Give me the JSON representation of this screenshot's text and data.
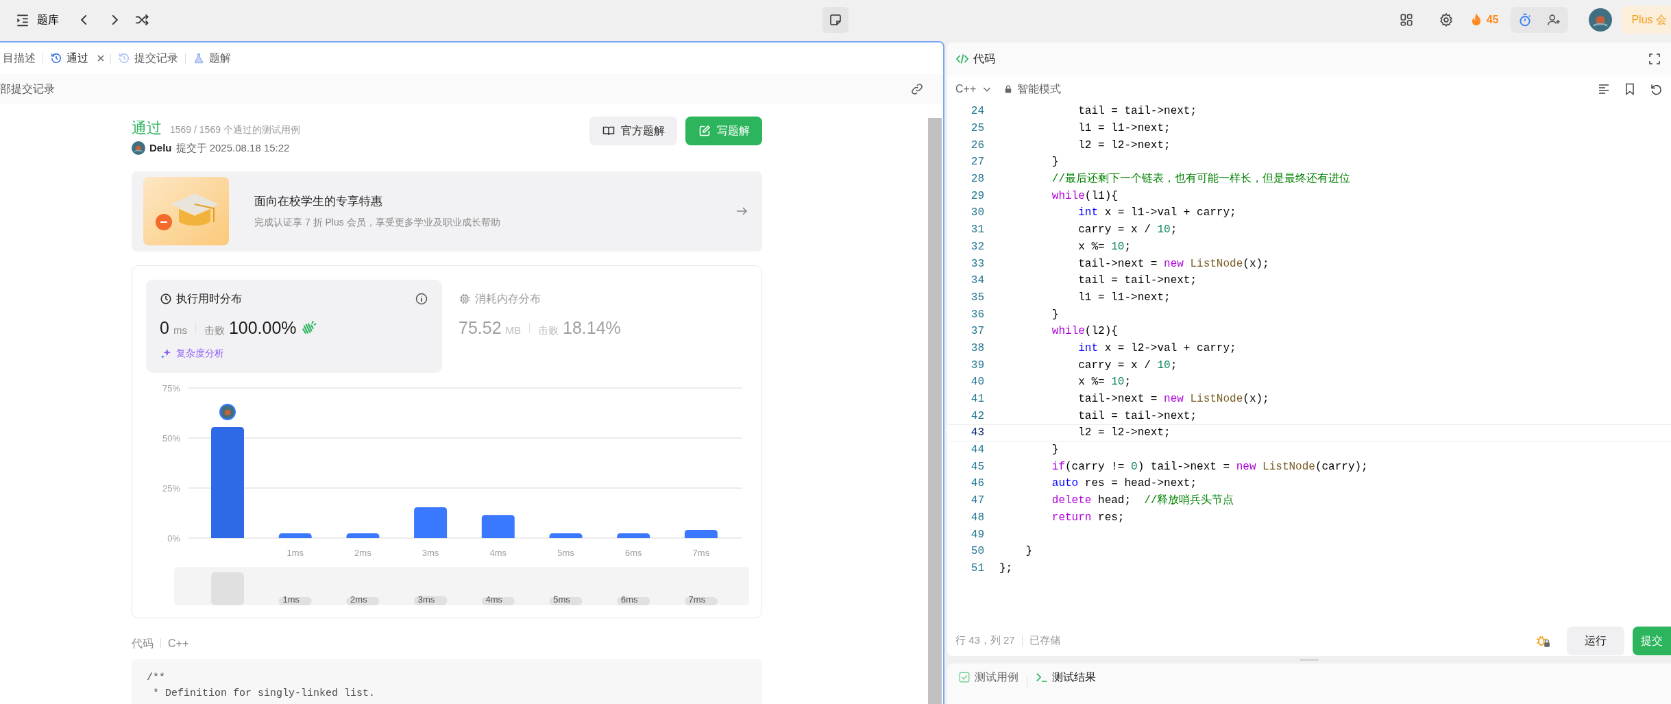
{
  "top_bar": {
    "title": "题库",
    "streak": "45",
    "plus_button": "Plus 会"
  },
  "left_panel": {
    "tabs": [
      {
        "label": "目描述",
        "kind": "description",
        "selected": false,
        "closable": false
      },
      {
        "label": "通过",
        "kind": "result",
        "selected": true,
        "closable": true
      },
      {
        "label": "提交记录",
        "kind": "submissions",
        "selected": false,
        "closable": false
      },
      {
        "label": "题解",
        "kind": "solutions",
        "selected": false,
        "closable": false
      }
    ],
    "back_link": "部提交记录",
    "submission": {
      "status": "通过",
      "testcases": "1569 / 1569 个通过的测试用例",
      "user": "Delu",
      "submitted": "提交于 2025.08.18 15:22",
      "buttons": [
        {
          "label": "官方题解",
          "kind": "secondary"
        },
        {
          "label": "写题解",
          "kind": "primary"
        }
      ]
    },
    "promo": {
      "title": "面向在校学生的专享特惠",
      "subtitle": "完成认证享 7 折 Plus 会员，享受更多学业及职业成长帮助"
    },
    "stats": [
      {
        "kind": "runtime",
        "title": "执行用时分布",
        "value": "0",
        "unit": "ms",
        "beats_label": "击败",
        "beats": "100.00%",
        "selected": true,
        "link": "复杂度分析"
      },
      {
        "kind": "memory",
        "title": "消耗内存分布",
        "value": "75.52",
        "unit": "MB",
        "beats_label": "击败",
        "beats": "18.14%",
        "selected": false
      }
    ],
    "chart_data": {
      "type": "bar",
      "categories": [
        null,
        "1ms",
        "2ms",
        "3ms",
        "4ms",
        "5ms",
        "6ms",
        "7ms"
      ],
      "values": [
        55.5,
        2.4,
        2.4,
        15.4,
        11.6,
        2.4,
        2.4,
        4.1
      ],
      "ylim": [
        0,
        75
      ],
      "yticks": [
        {
          "value": 0,
          "label": "0%"
        },
        {
          "value": 25,
          "label": "25%"
        },
        {
          "value": 50,
          "label": "50%"
        },
        {
          "value": 75,
          "label": "75%"
        }
      ]
    },
    "range_labels": [
      "1ms",
      "2ms",
      "3ms",
      "4ms",
      "5ms",
      "6ms",
      "7ms"
    ],
    "code_label": "代码",
    "code_language": "C++",
    "code": [
      "/**",
      " * Definition for singly-linked list."
    ]
  },
  "editor": {
    "title": "代码",
    "language": "C++",
    "mode": "智能模式",
    "lines": [
      {
        "num": "24",
        "current": false,
        "tokens": [
          {
            "kind": "plain",
            "text": "            tail = tail->next;"
          }
        ]
      },
      {
        "num": "25",
        "current": false,
        "tokens": [
          {
            "kind": "plain",
            "text": "            l1 = l1->next;"
          }
        ]
      },
      {
        "num": "26",
        "current": false,
        "tokens": [
          {
            "kind": "plain",
            "text": "            l2 = l2->next;"
          }
        ]
      },
      {
        "num": "27",
        "current": false,
        "tokens": [
          {
            "kind": "plain",
            "text": "        }"
          }
        ]
      },
      {
        "num": "28",
        "current": false,
        "tokens": [
          {
            "kind": "comment",
            "text": "        //最后还剩下一个链表，也有可能一样长，但是最终还有进位"
          }
        ]
      },
      {
        "num": "29",
        "current": false,
        "tokens": [
          {
            "kind": "keyword",
            "text": "        while"
          },
          {
            "kind": "plain",
            "text": "(l1){"
          }
        ]
      },
      {
        "num": "30",
        "current": false,
        "tokens": [
          {
            "kind": "type",
            "text": "            int"
          },
          {
            "kind": "plain",
            "text": " x = l1->val + carry;"
          }
        ]
      },
      {
        "num": "31",
        "current": false,
        "tokens": [
          {
            "kind": "plain",
            "text": "            carry = x / "
          },
          {
            "kind": "number",
            "text": "10"
          },
          {
            "kind": "plain",
            "text": ";"
          }
        ]
      },
      {
        "num": "32",
        "current": false,
        "tokens": [
          {
            "kind": "plain",
            "text": "            x %= "
          },
          {
            "kind": "number",
            "text": "10"
          },
          {
            "kind": "plain",
            "text": ";"
          }
        ]
      },
      {
        "num": "33",
        "current": false,
        "tokens": [
          {
            "kind": "plain",
            "text": "            tail->next = "
          },
          {
            "kind": "keyword",
            "text": "new"
          },
          {
            "kind": "function",
            "text": " ListNode"
          },
          {
            "kind": "plain",
            "text": "(x);"
          }
        ]
      },
      {
        "num": "34",
        "current": false,
        "tokens": [
          {
            "kind": "plain",
            "text": "            tail = tail->next;"
          }
        ]
      },
      {
        "num": "35",
        "current": false,
        "tokens": [
          {
            "kind": "plain",
            "text": "            l1 = l1->next;"
          }
        ]
      },
      {
        "num": "36",
        "current": false,
        "tokens": [
          {
            "kind": "plain",
            "text": "        }"
          }
        ]
      },
      {
        "num": "37",
        "current": false,
        "tokens": [
          {
            "kind": "keyword",
            "text": "        while"
          },
          {
            "kind": "plain",
            "text": "(l2){"
          }
        ]
      },
      {
        "num": "38",
        "current": false,
        "tokens": [
          {
            "kind": "type",
            "text": "            int"
          },
          {
            "kind": "plain",
            "text": " x = l2->val + carry;"
          }
        ]
      },
      {
        "num": "39",
        "current": false,
        "tokens": [
          {
            "kind": "plain",
            "text": "            carry = x / "
          },
          {
            "kind": "number",
            "text": "10"
          },
          {
            "kind": "plain",
            "text": ";"
          }
        ]
      },
      {
        "num": "40",
        "current": false,
        "tokens": [
          {
            "kind": "plain",
            "text": "            x %= "
          },
          {
            "kind": "number",
            "text": "10"
          },
          {
            "kind": "plain",
            "text": ";"
          }
        ]
      },
      {
        "num": "41",
        "current": false,
        "tokens": [
          {
            "kind": "plain",
            "text": "            tail->next = "
          },
          {
            "kind": "keyword",
            "text": "new"
          },
          {
            "kind": "function",
            "text": " ListNode"
          },
          {
            "kind": "plain",
            "text": "(x);"
          }
        ]
      },
      {
        "num": "42",
        "current": false,
        "tokens": [
          {
            "kind": "plain",
            "text": "            tail = tail->next;"
          }
        ]
      },
      {
        "num": "43",
        "current": true,
        "tokens": [
          {
            "kind": "plain",
            "text": "            l2 = l2->next;"
          }
        ]
      },
      {
        "num": "44",
        "current": false,
        "tokens": [
          {
            "kind": "plain",
            "text": "        }"
          }
        ]
      },
      {
        "num": "45",
        "current": false,
        "tokens": [
          {
            "kind": "keyword",
            "text": "        if"
          },
          {
            "kind": "plain",
            "text": "(carry != "
          },
          {
            "kind": "number",
            "text": "0"
          },
          {
            "kind": "plain",
            "text": ") tail->next = "
          },
          {
            "kind": "keyword",
            "text": "new"
          },
          {
            "kind": "function",
            "text": " ListNode"
          },
          {
            "kind": "plain",
            "text": "(carry);"
          }
        ]
      },
      {
        "num": "46",
        "current": false,
        "tokens": [
          {
            "kind": "type",
            "text": "        auto"
          },
          {
            "kind": "plain",
            "text": " res = head->next;"
          }
        ]
      },
      {
        "num": "47",
        "current": false,
        "tokens": [
          {
            "kind": "keyword",
            "text": "        delete"
          },
          {
            "kind": "plain",
            "text": " head;  "
          },
          {
            "kind": "comment",
            "text": "//释放哨兵头节点"
          }
        ]
      },
      {
        "num": "48",
        "current": false,
        "tokens": [
          {
            "kind": "keyword",
            "text": "        return"
          },
          {
            "kind": "plain",
            "text": " res;"
          }
        ]
      },
      {
        "num": "49",
        "current": false
      },
      {
        "num": "50",
        "current": false,
        "tokens": [
          {
            "kind": "plain",
            "text": "    }"
          }
        ]
      },
      {
        "num": "51",
        "current": false,
        "tokens": [
          {
            "kind": "plain",
            "text": "};"
          }
        ]
      }
    ],
    "status": {
      "position": "行 43，列 27",
      "saved": "已存储"
    },
    "buttons": [
      {
        "label": "运行",
        "kind": "secondary"
      },
      {
        "label": "提交",
        "kind": "primary"
      }
    ]
  },
  "bottom_tabs": [
    {
      "label": "测试用例",
      "kind": "testcase",
      "selected": false
    },
    {
      "label": "测试结果",
      "kind": "result",
      "selected": true
    }
  ]
}
